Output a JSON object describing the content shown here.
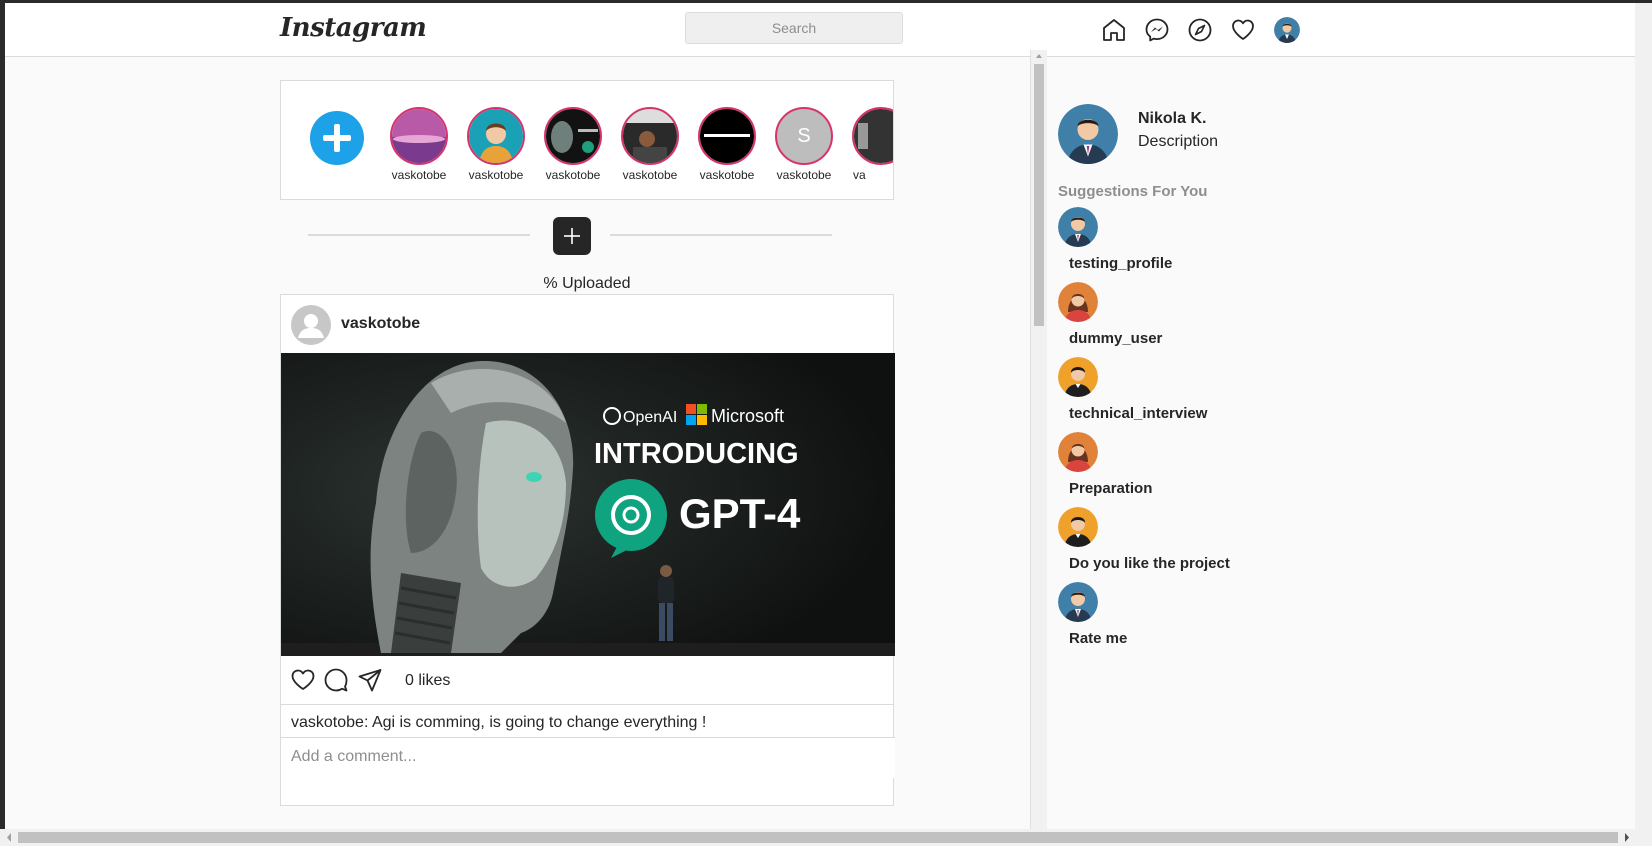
{
  "header": {
    "logo": "Instagram",
    "search_placeholder": "Search",
    "icons": [
      "home-icon",
      "messenger-icon",
      "explore-icon",
      "heart-icon",
      "profile-avatar"
    ]
  },
  "stories": {
    "add_icon": "plus-icon",
    "items": [
      {
        "name": "vaskotobe"
      },
      {
        "name": "vaskotobe"
      },
      {
        "name": "vaskotobe"
      },
      {
        "name": "vaskotobe"
      },
      {
        "name": "vaskotobe"
      },
      {
        "name": "vaskotobe",
        "initial": "S"
      },
      {
        "name": "va"
      }
    ]
  },
  "upload": {
    "status": "% Uploaded"
  },
  "post": {
    "username": "vaskotobe",
    "image_text": {
      "brand_left": "OpenAI",
      "brand_right": "Microsoft",
      "headline": "INTRODUCING",
      "product": "GPT-4"
    },
    "likes": "0 likes",
    "caption": "vaskotobe: Agi is comming, is going to change everything !",
    "comment_placeholder": "Add a comment..."
  },
  "sidebar": {
    "profile": {
      "name": "Nikola K.",
      "description": "Description"
    },
    "suggestions_title": "Suggestions For You",
    "suggestions": [
      {
        "name": "testing_profile",
        "avatar": "male-suit-avatar"
      },
      {
        "name": "dummy_user",
        "avatar": "female-avatar"
      },
      {
        "name": "technical_interview",
        "avatar": "male-dark-avatar"
      },
      {
        "name": "Preparation",
        "avatar": "female-avatar"
      },
      {
        "name": "Do you like the project",
        "avatar": "male-dark-avatar"
      },
      {
        "name": "Rate me",
        "avatar": "male-suit-avatar"
      }
    ]
  },
  "colors": {
    "story_ring": "#d6336c",
    "add_story": "#1da1e8",
    "upload_button": "#262626"
  }
}
